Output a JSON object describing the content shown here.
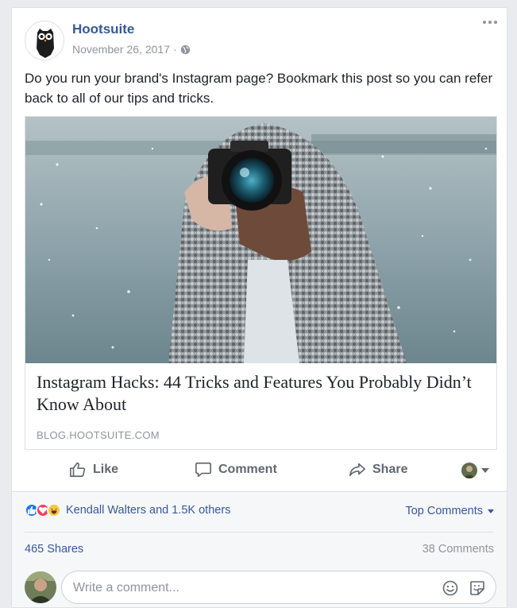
{
  "post": {
    "page_name": "Hootsuite",
    "date": "November 26, 2017",
    "separator": "·",
    "text": "Do you run your brand's Instagram page? Bookmark this post so you can refer back to all of our tips and tricks."
  },
  "link_preview": {
    "title": "Instagram Hacks: 44 Tricks and Features You Probably Didn’t Know About",
    "domain": "BLOG.HOOTSUITE.COM"
  },
  "actions": {
    "like": "Like",
    "comment": "Comment",
    "share": "Share"
  },
  "engagement": {
    "reactors": "Kendall Walters and 1.5K others",
    "sort_label": "Top Comments",
    "shares": "465 Shares",
    "comments": "38 Comments"
  },
  "composer": {
    "placeholder": "Write a comment..."
  },
  "icons": {
    "menu": "more-icon",
    "privacy": "globe-icon",
    "like": "thumbs-up-icon",
    "comment": "speech-bubble-icon",
    "share": "share-arrow-icon",
    "emoji": "smiley-icon",
    "sticker": "sticker-icon"
  },
  "colors": {
    "link": "#365899",
    "like_reaction": "#1877f2",
    "love_reaction": "#f33e58",
    "haha_reaction": "#fcc744"
  }
}
